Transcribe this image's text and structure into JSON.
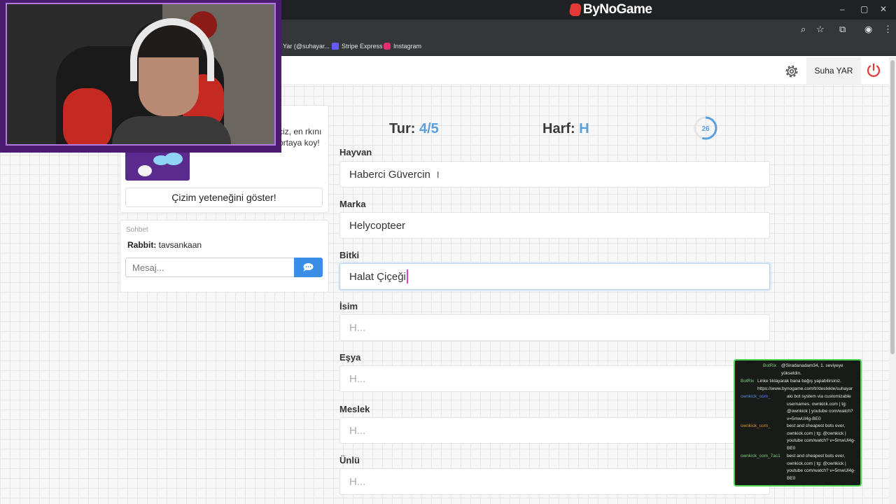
{
  "browser": {
    "brand": "ByNoGame",
    "window_controls": [
      "–",
      "▢",
      "✕"
    ],
    "bookmarks": [
      {
        "label": "Yar (@suhayar...",
        "color": "#cccccc"
      },
      {
        "label": "Stripe Express",
        "color": "#635bff"
      },
      {
        "label": "Instagram",
        "color": "#e1306c"
      }
    ]
  },
  "nav": {
    "user_name": "Suha YAR",
    "settings_icon": "gear-icon",
    "logout_icon": "power-icon",
    "accent": "#e53935"
  },
  "promo": {
    "text": "çiz, en rkını ortaya koy!",
    "button": "Çizim yeteneğini göster!"
  },
  "chat": {
    "title": "Sohbet",
    "messages": [
      {
        "user": "Rabbit:",
        "text": "tavsankaan"
      }
    ],
    "input_placeholder": "Mesaj...",
    "send_icon": "chat-bubble-icon",
    "send_color": "#3a8ee6"
  },
  "game": {
    "round_label": "Tur:",
    "round_value": "4/5",
    "letter_label": "Harf:",
    "letter_value": "H",
    "timer": "26",
    "timer_fraction": 0.55,
    "accent": "#5aa0de",
    "fields": [
      {
        "label": "Hayvan",
        "value": "Haberci Güvercin",
        "placeholder": "H..."
      },
      {
        "label": "Marka",
        "value": "Helycopteer",
        "placeholder": "H..."
      },
      {
        "label": "Bitki",
        "value": "Halat Çiçeği",
        "placeholder": "H..."
      },
      {
        "label": "İsim",
        "value": "",
        "placeholder": "H..."
      },
      {
        "label": "Eşya",
        "value": "",
        "placeholder": "H..."
      },
      {
        "label": "Meslek",
        "value": "",
        "placeholder": "H..."
      },
      {
        "label": "Ünlü",
        "value": "",
        "placeholder": "H..."
      }
    ]
  },
  "stream_chat": [
    {
      "user": "BotRix",
      "user_color": "#7bd17b",
      "text": "@Siradanadam34, 1. seviyeye yükseldin."
    },
    {
      "user": "BotRix",
      "user_color": "#7bd17b",
      "text": "Linke tıklayarak bana bağış yapabilirsiniz. https://www.bynogame.com/tr/destekle/suhayar"
    },
    {
      "user": "ownkick_com_",
      "user_color": "#5a8bd6",
      "text": "alo bot system via customizable usernames. ownkick.com | tg: @ownkick | youtube com/watch?v=5mwUl4g-BE0"
    },
    {
      "user": "ownkick_com_",
      "user_color": "#d6943a",
      "text": "best and cheapest bots ever, ownkick.com | tg: @ownkick | youtube com/watch? v=5mwUl4g-BE0"
    },
    {
      "user": "ownkick_com_7ac1",
      "user_color": "#7bd17b",
      "text": "best and cheapest bots ever, ownkick.com | tg: @ownkick | youtube com/watch? v=5mwUl4g-BE0"
    }
  ]
}
